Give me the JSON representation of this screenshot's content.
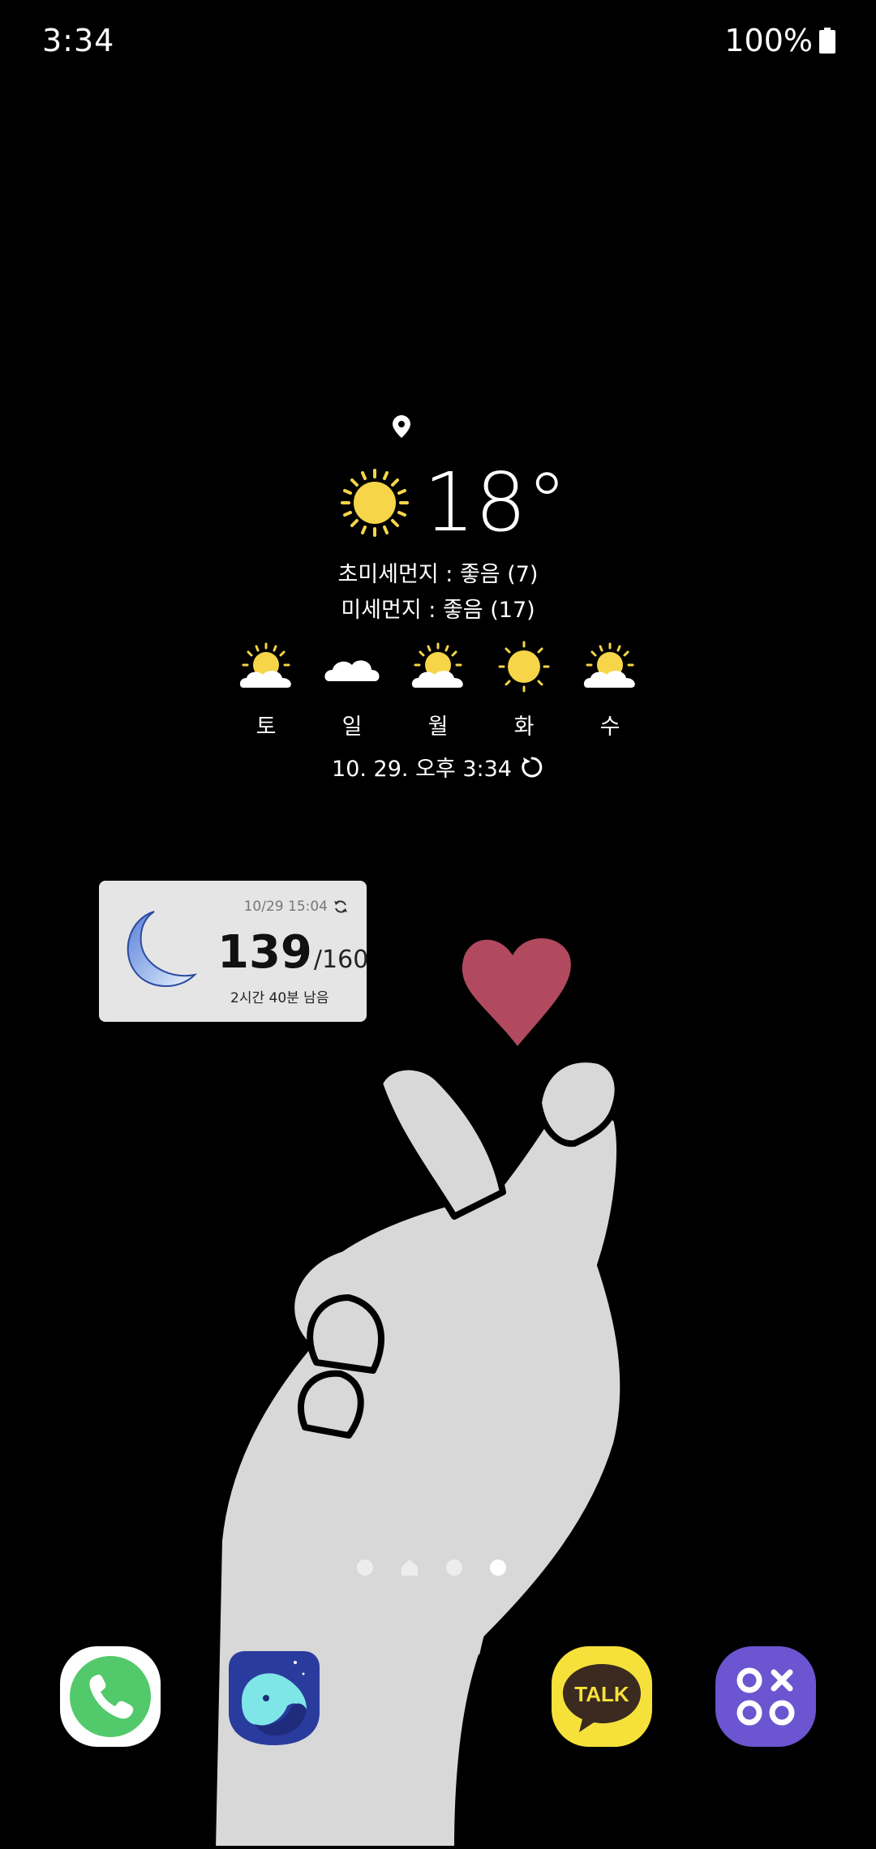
{
  "status_bar": {
    "time": "3:34",
    "battery": "100%"
  },
  "weather": {
    "temperature": "18°",
    "ultrafine_dust": "초미세먼지 : 좋음 (7)",
    "fine_dust": "미세먼지 : 좋음 (17)",
    "forecast": [
      {
        "day": "토",
        "icon": "partly-sunny-icon"
      },
      {
        "day": "일",
        "icon": "cloud-icon"
      },
      {
        "day": "월",
        "icon": "partly-sunny-icon"
      },
      {
        "day": "화",
        "icon": "sun-icon"
      },
      {
        "day": "수",
        "icon": "partly-sunny-icon"
      }
    ],
    "updated": "10. 29. 오후 3:34"
  },
  "sleep_widget": {
    "date": "10/29 15:04",
    "current": "139",
    "total": "/160",
    "remaining": "2시간 40분 남음"
  },
  "page_indicator": {
    "pages": 4,
    "active_index": 3
  },
  "dock": {
    "apps": [
      "phone-icon",
      "naver-whale-icon",
      "kakaotalk-icon",
      "game-launcher-icon"
    ],
    "kakaotalk_label": "TALK"
  },
  "colors": {
    "sun": "#f6d548",
    "heart": "#b14a5e",
    "hand": "#d8d8d8",
    "phone_green": "#52c96a",
    "kakao_yellow": "#f6e13a",
    "game_purple": "#6b55d0"
  }
}
